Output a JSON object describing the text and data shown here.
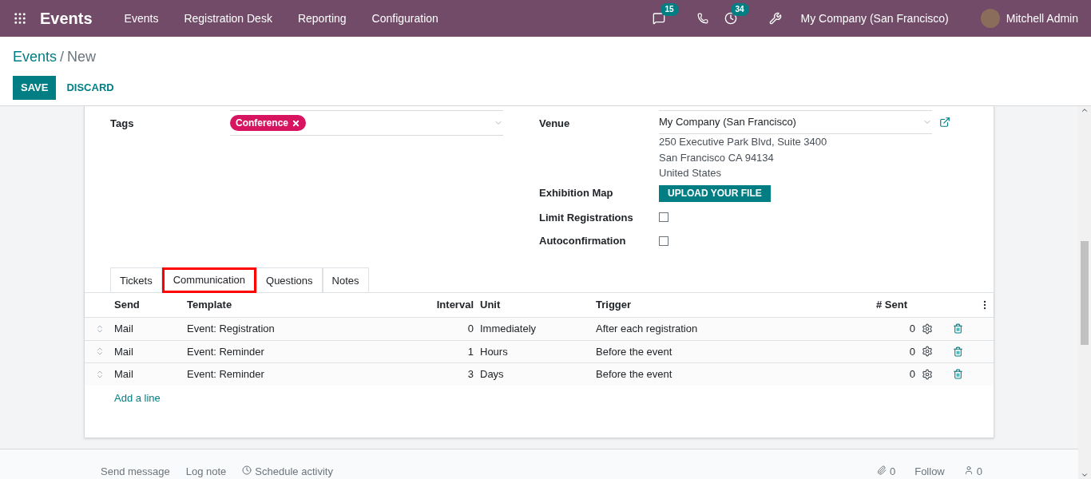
{
  "navbar": {
    "app_name": "Events",
    "menu": [
      "Events",
      "Registration Desk",
      "Reporting",
      "Configuration"
    ],
    "messages_count": "15",
    "activities_count": "34",
    "company": "My Company (San Francisco)",
    "user": "Mitchell Admin"
  },
  "breadcrumb": {
    "parent": "Events",
    "separator": "/",
    "current": "New"
  },
  "actions": {
    "save": "SAVE",
    "discard": "DISCARD"
  },
  "form": {
    "tags_label": "Tags",
    "tags": [
      {
        "label": "Conference",
        "color": "#d6145f"
      }
    ],
    "venue_label": "Venue",
    "venue": "My Company (San Francisco)",
    "address": [
      "250 Executive Park Blvd, Suite 3400",
      "San Francisco CA 94134",
      "United States"
    ],
    "exhibition_map_label": "Exhibition Map",
    "upload_button": "UPLOAD YOUR FILE",
    "checkboxes": [
      {
        "label": "Limit Registrations",
        "checked": false
      },
      {
        "label": "Autoconfirmation",
        "checked": false
      }
    ]
  },
  "tabs": [
    {
      "label": "Tickets",
      "selected": false
    },
    {
      "label": "Communication",
      "selected": true
    },
    {
      "label": "Questions",
      "selected": false
    },
    {
      "label": "Notes",
      "selected": false
    }
  ],
  "table": {
    "columns": [
      "Send",
      "Template",
      "Interval",
      "Unit",
      "Trigger",
      "# Sent"
    ],
    "rows": [
      {
        "send": "Mail",
        "template": "Event: Registration",
        "interval": "0",
        "unit": "Immediately",
        "trigger": "After each registration",
        "sent": "0"
      },
      {
        "send": "Mail",
        "template": "Event: Reminder",
        "interval": "1",
        "unit": "Hours",
        "trigger": "Before the event",
        "sent": "0"
      },
      {
        "send": "Mail",
        "template": "Event: Reminder",
        "interval": "3",
        "unit": "Days",
        "trigger": "Before the event",
        "sent": "0"
      }
    ],
    "add_line": "Add a line"
  },
  "chatter": {
    "actions": [
      "Send message",
      "Log note",
      "Schedule activity"
    ],
    "attachments": "0",
    "follow": "Follow",
    "followers": "0"
  }
}
